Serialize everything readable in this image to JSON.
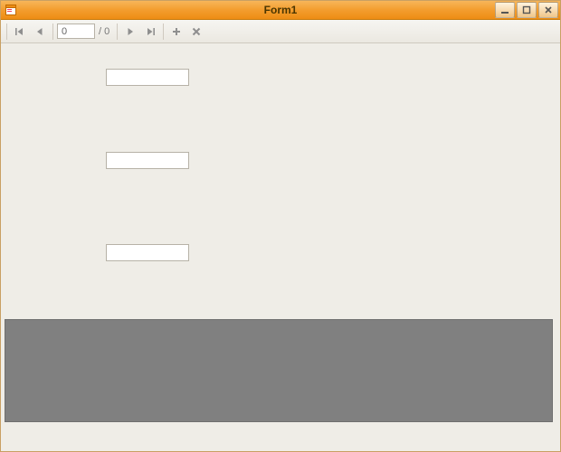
{
  "title": "Form1",
  "navigator": {
    "position_value": "0",
    "count_text": "/ 0"
  },
  "fields": {
    "textbox1": "",
    "textbox2": "",
    "textbox3": ""
  },
  "icons": {
    "app": "form-icon",
    "minimize": "minimize-icon",
    "maximize": "maximize-icon",
    "close": "close-icon",
    "first": "move-first-icon",
    "prev": "move-previous-icon",
    "next": "move-next-icon",
    "last": "move-last-icon",
    "add": "add-new-icon",
    "delete": "delete-icon"
  }
}
